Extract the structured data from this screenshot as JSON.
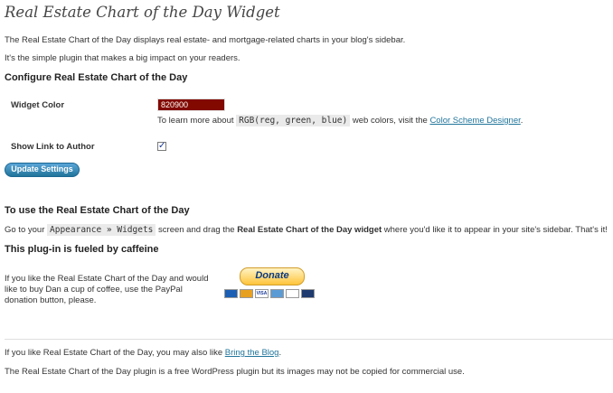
{
  "page": {
    "title": "Real Estate Chart of the Day Widget",
    "intro1": "The Real Estate Chart of the Day displays real estate- and mortgage-related charts in your blog's sidebar.",
    "intro2": "It's the simple plugin that makes a big impact on your readers."
  },
  "configure": {
    "heading": "Configure Real Estate Chart of the Day",
    "widget_color_label": "Widget Color",
    "widget_color_value": "820900",
    "widget_color_bg": "#820900",
    "help_prefix": "To learn more about",
    "help_code": "RGB(reg, green, blue)",
    "help_mid": "web colors, visit the",
    "help_link": "Color Scheme Designer",
    "help_suffix": ".",
    "show_link_label": "Show Link to Author",
    "show_link_checked": true,
    "update_button": "Update Settings"
  },
  "usage": {
    "heading": "To use the Real Estate Chart of the Day",
    "text_prefix": "Go to your",
    "code": "Appearance » Widgets",
    "text_mid": "screen and drag the",
    "bold": "Real Estate Chart of the Day widget",
    "text_suffix": "where you'd like it to appear in your site's sidebar. That's it!"
  },
  "caffeine": {
    "heading": "This plug-in is fueled by caffeine",
    "line1": "If you like the Real Estate Chart of the Day and would",
    "line2": "like to buy Dan a cup of coffee, use the PayPal",
    "line3": "donation button, please.",
    "donate_label": "Donate",
    "cards": [
      "Maestro",
      "MC",
      "VISA",
      "AMEX",
      "DISC",
      "BANK"
    ]
  },
  "footer": {
    "also_prefix": "If you like Real Estate Chart of the Day, you may also like",
    "also_link": "Bring the Blog",
    "also_suffix": ".",
    "notice": "The Real Estate Chart of the Day plugin is a free WordPress plugin but its images may not be copied for commercial use."
  }
}
